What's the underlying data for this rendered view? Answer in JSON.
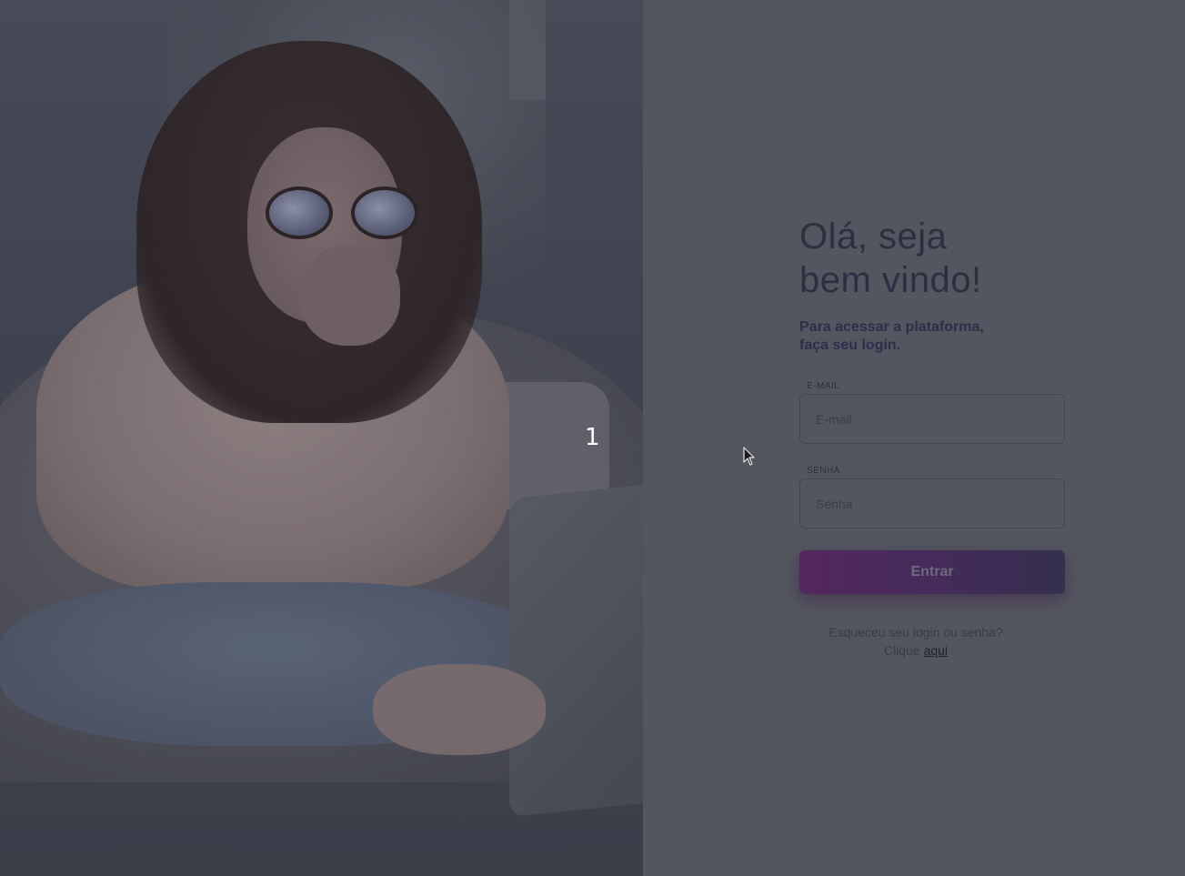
{
  "hero": {
    "slide_indicator": "1"
  },
  "login": {
    "greeting_line1": "Olá, seja",
    "greeting_line2": "bem vindo!",
    "subtitle_line1": "Para acessar a plataforma,",
    "subtitle_line2": "faça seu login.",
    "email_label": "E-MAIL",
    "email_placeholder": "E-mail",
    "email_value": "",
    "password_label": "SENHA",
    "password_placeholder": "Senha",
    "password_value": "",
    "submit_label": "Entrar",
    "forgot_text": "Esqueceu seu login ou senha?",
    "forgot_click_prefix": "Clique",
    "forgot_link": "aqui"
  },
  "colors": {
    "page_background": "#53565f",
    "heading": "#2d2e42",
    "button_gradient_start": "#54285f",
    "button_gradient_end": "#34304d"
  },
  "icons": {
    "cursor": "mouse-pointer-icon"
  }
}
